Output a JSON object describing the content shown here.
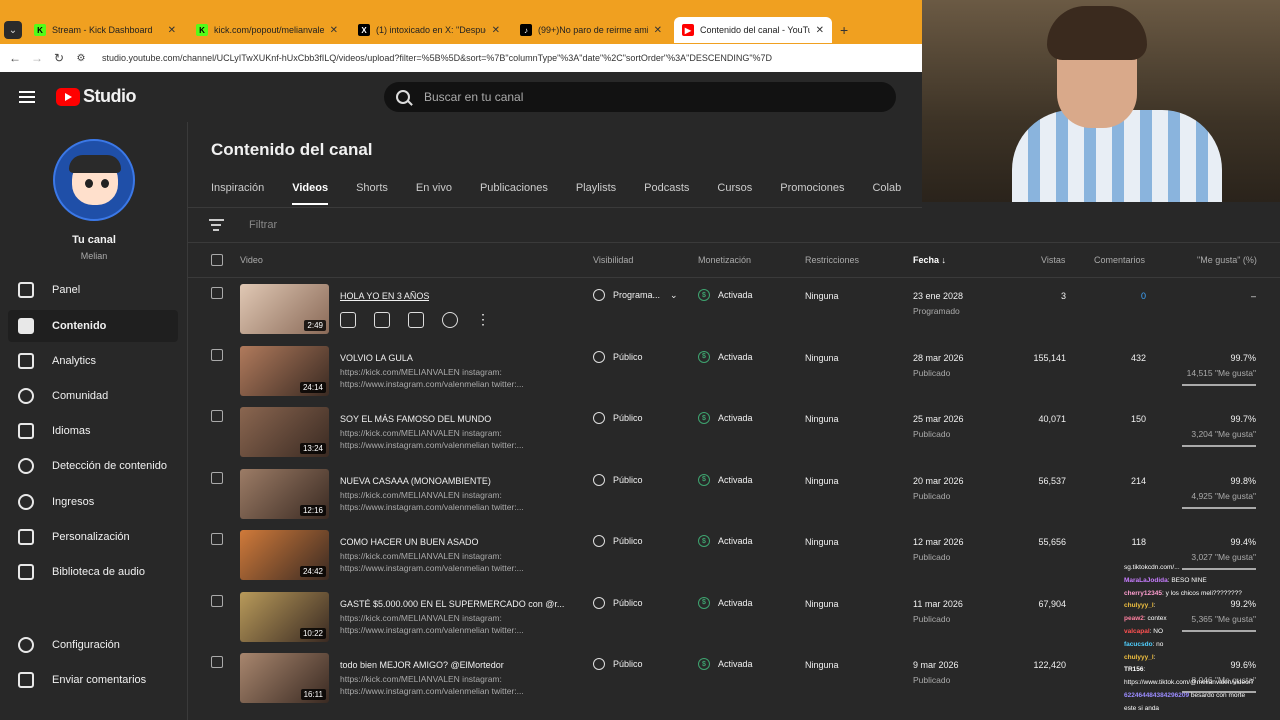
{
  "browser": {
    "tabs": [
      {
        "title": "Stream - Kick Dashboard",
        "icon": "K",
        "color": "#53fc18"
      },
      {
        "title": "kick.com/popout/melianvalen/...",
        "icon": "K",
        "color": "#53fc18"
      },
      {
        "title": "(1) intoxicado en X: \"Despues de...",
        "icon": "X",
        "color": "#000000"
      },
      {
        "title": "(99+)No paro de reirme amigo...",
        "icon": "♪",
        "color": "#000000"
      },
      {
        "title": "Contenido del canal - YouTube...",
        "icon": "▶",
        "color": "#ff0000"
      }
    ],
    "url": "studio.youtube.com/channel/UCLyITwXUKnf-hUxCbb3fILQ/videos/upload?filter=%5B%5D&sort=%7B\"columnType\"%3A\"date\"%2C\"sortOrder\"%3A\"DESCENDING\"%7D"
  },
  "header": {
    "brand": "Studio",
    "search_placeholder": "Buscar en tu canal"
  },
  "channel": {
    "name": "Tu canal",
    "handle": "Melian"
  },
  "sidebar": {
    "items": [
      {
        "label": "Panel",
        "icon": "dashboard-icon"
      },
      {
        "label": "Contenido",
        "icon": "content-icon",
        "selected": true
      },
      {
        "label": "Analytics",
        "icon": "analytics-icon"
      },
      {
        "label": "Comunidad",
        "icon": "community-icon"
      },
      {
        "label": "Idiomas",
        "icon": "subtitles-icon"
      },
      {
        "label": "Detección de contenido",
        "icon": "copyright-icon"
      },
      {
        "label": "Ingresos",
        "icon": "dollar-icon"
      },
      {
        "label": "Personalización",
        "icon": "magic-wand-icon"
      },
      {
        "label": "Biblioteca de audio",
        "icon": "audio-library-icon"
      }
    ],
    "bottom": [
      {
        "label": "Configuración",
        "icon": "gear-icon"
      },
      {
        "label": "Enviar comentarios",
        "icon": "feedback-icon"
      }
    ]
  },
  "main": {
    "title": "Contenido del canal",
    "tabs": [
      "Inspiración",
      "Videos",
      "Shorts",
      "En vivo",
      "Publicaciones",
      "Playlists",
      "Podcasts",
      "Cursos",
      "Promociones",
      "Colab"
    ],
    "active_tab": "Videos",
    "filter_placeholder": "Filtrar",
    "columns": {
      "video": "Video",
      "visibility": "Visibilidad",
      "monetization": "Monetización",
      "restrictions": "Restricciones",
      "date": "Fecha",
      "views": "Vistas",
      "comments": "Comentarios",
      "likes": "\"Me gusta\" (%)"
    }
  },
  "videos": [
    {
      "title": "HOLA YO EN 3 AÑOS",
      "duration": "2:49",
      "desc1": "",
      "desc2": "",
      "visibility": "Programa...",
      "monetization": "Activada",
      "restrictions": "Ninguna",
      "date": "23 ene 2028",
      "status": "Programado",
      "views": "3",
      "comments": "0",
      "likes": "–",
      "likes_sub": "",
      "thumb": "#c9a890"
    },
    {
      "title": "VOLVIO LA GULA",
      "duration": "24:14",
      "desc1": "https://kick.com/MELIANVALEN instagram:",
      "desc2": "https://www.instagram.com/valenmelian twitter:...",
      "visibility": "Público",
      "monetization": "Activada",
      "restrictions": "Ninguna",
      "date": "28 mar 2026",
      "status": "Publicado",
      "views": "155,141",
      "comments": "432",
      "likes": "99.7%",
      "likes_sub": "14,515 \"Me gusta\"",
      "thumb": "#b07a5c"
    },
    {
      "title": "SOY EL MÁS FAMOSO DEL MUNDO",
      "duration": "13:24",
      "desc1": "https://kick.com/MELIANVALEN instagram:",
      "desc2": "https://www.instagram.com/valenmelian twitter:...",
      "visibility": "Público",
      "monetization": "Activada",
      "restrictions": "Ninguna",
      "date": "25 mar 2026",
      "status": "Publicado",
      "views": "40,071",
      "comments": "150",
      "likes": "99.7%",
      "likes_sub": "3,204 \"Me gusta\"",
      "thumb": "#8a6650"
    },
    {
      "title": "NUEVA CASAAA (MONOAMBIENTE)",
      "duration": "12:16",
      "desc1": "https://kick.com/MELIANVALEN instagram:",
      "desc2": "https://www.instagram.com/valenmelian twitter:...",
      "visibility": "Público",
      "monetization": "Activada",
      "restrictions": "Ninguna",
      "date": "20 mar 2026",
      "status": "Publicado",
      "views": "56,537",
      "comments": "214",
      "likes": "99.8%",
      "likes_sub": "4,925 \"Me gusta\"",
      "thumb": "#9c7c66"
    },
    {
      "title": "COMO HACER UN BUEN ASADO",
      "duration": "24:42",
      "desc1": "https://kick.com/MELIANVALEN instagram:",
      "desc2": "https://www.instagram.com/valenmelian twitter:...",
      "visibility": "Público",
      "monetization": "Activada",
      "restrictions": "Ninguna",
      "date": "12 mar 2026",
      "status": "Publicado",
      "views": "55,656",
      "comments": "118",
      "likes": "99.4%",
      "likes_sub": "3,027 \"Me gusta\"",
      "thumb": "#d07a3a"
    },
    {
      "title": "GASTÉ $5.000.000 EN EL SUPERMERCADO con @r...",
      "duration": "10:22",
      "desc1": "https://kick.com/MELIANVALEN instagram:",
      "desc2": "https://www.instagram.com/valenmelian twitter:...",
      "visibility": "Público",
      "monetization": "Activada",
      "restrictions": "Ninguna",
      "date": "11 mar 2026",
      "status": "Publicado",
      "views": "67,904",
      "comments": "",
      "likes": "99.2%",
      "likes_sub": "5,365 \"Me gusta\"",
      "thumb": "#b89a5a"
    },
    {
      "title": "todo bien MEJOR AMIGO? @ElMortedor",
      "duration": "16:11",
      "desc1": "https://kick.com/MELIANVALEN instagram:",
      "desc2": "https://www.instagram.com/valenmelian twitter:...",
      "visibility": "Público",
      "monetization": "Activada",
      "restrictions": "Ninguna",
      "date": "9 mar 2026",
      "status": "Publicado",
      "views": "122,420",
      "comments": "",
      "likes": "99.6%",
      "likes_sub": "8,046 \"Me gusta\"",
      "thumb": "#a8866e"
    }
  ],
  "chat": [
    {
      "user": "",
      "msg": "sg.tiktokcdn.com/...",
      "color": "#9b8cff"
    },
    {
      "user": "MaraLaJodida",
      "msg": ": BESO NINE",
      "color": "#c77dff"
    },
    {
      "user": "cherry12345",
      "msg": ": y los chicos meli????????",
      "color": "#ff9ed0"
    },
    {
      "user": "chulyyy_l",
      "msg": ":",
      "color": "#f0c040"
    },
    {
      "user": "peaw2",
      "msg": ": contex",
      "color": "#ff80a0"
    },
    {
      "user": "valcapal",
      "msg": ": NO",
      "color": "#ff5050"
    },
    {
      "user": "facucsdo",
      "msg": ": no",
      "color": "#50d0ff"
    },
    {
      "user": "chulyyy_l",
      "msg": ":",
      "color": "#f0c040"
    },
    {
      "user": "TR156",
      "msg": ":",
      "color": "#ffffff"
    },
    {
      "user": "",
      "msg": "https://www.tiktok.com/@melianvalen/video/7",
      "color": "#9b8cff"
    },
    {
      "user": "622464484384296209",
      "msg": " besardo con morte",
      "color": "#9b8cff"
    },
    {
      "user": "",
      "msg": "este si anda",
      "color": "#ffffff"
    }
  ]
}
